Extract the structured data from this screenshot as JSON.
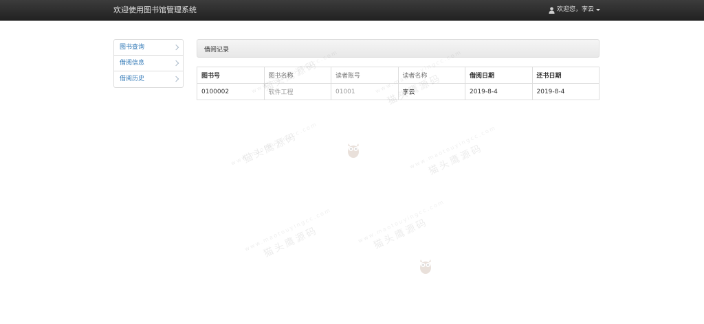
{
  "navbar": {
    "brand": "欢迎使用图书馆管理系统",
    "user_greeting": "欢迎您，李云",
    "user_icon": "user-icon",
    "caret_icon": "caret-down-icon"
  },
  "sidebar": {
    "items": [
      {
        "label": "图书查询",
        "icon": "chevron-right-icon"
      },
      {
        "label": "借阅信息",
        "icon": "chevron-right-icon"
      },
      {
        "label": "借阅历史",
        "icon": "chevron-right-icon"
      }
    ]
  },
  "panel": {
    "title": "借阅记录"
  },
  "table": {
    "headers": [
      "图书号",
      "图书名称",
      "读者账号",
      "读者名称",
      "借阅日期",
      "还书日期"
    ],
    "rows": [
      [
        "0100002",
        "软件工程",
        "01001",
        "李云",
        "2019-8-4",
        "2019-8-4"
      ]
    ]
  },
  "watermark": {
    "text": "猫头鹰源码",
    "url": "www.maotouyingcc.com"
  },
  "colors": {
    "navbar_bg": "#222222",
    "link": "#337ab7",
    "border": "#dddddd"
  }
}
